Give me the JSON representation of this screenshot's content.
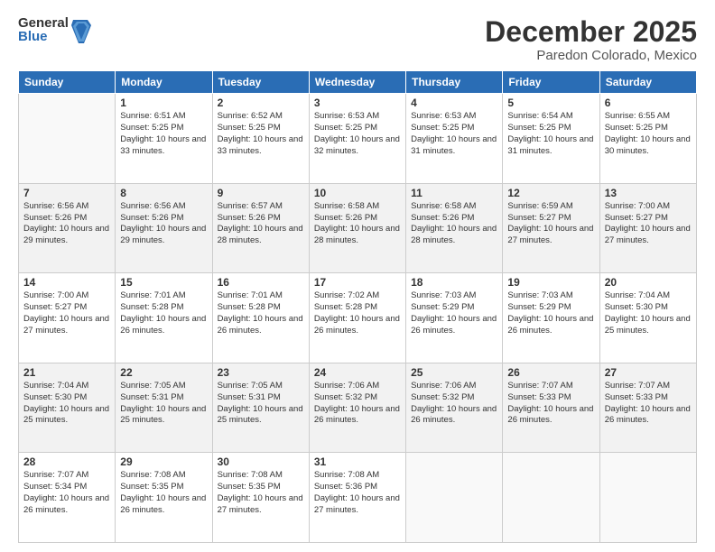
{
  "logo": {
    "general": "General",
    "blue": "Blue"
  },
  "title": "December 2025",
  "location": "Paredon Colorado, Mexico",
  "days_of_week": [
    "Sunday",
    "Monday",
    "Tuesday",
    "Wednesday",
    "Thursday",
    "Friday",
    "Saturday"
  ],
  "weeks": [
    [
      {
        "day": "",
        "info": ""
      },
      {
        "day": "1",
        "info": "Sunrise: 6:51 AM\nSunset: 5:25 PM\nDaylight: 10 hours\nand 33 minutes."
      },
      {
        "day": "2",
        "info": "Sunrise: 6:52 AM\nSunset: 5:25 PM\nDaylight: 10 hours\nand 33 minutes."
      },
      {
        "day": "3",
        "info": "Sunrise: 6:53 AM\nSunset: 5:25 PM\nDaylight: 10 hours\nand 32 minutes."
      },
      {
        "day": "4",
        "info": "Sunrise: 6:53 AM\nSunset: 5:25 PM\nDaylight: 10 hours\nand 31 minutes."
      },
      {
        "day": "5",
        "info": "Sunrise: 6:54 AM\nSunset: 5:25 PM\nDaylight: 10 hours\nand 31 minutes."
      },
      {
        "day": "6",
        "info": "Sunrise: 6:55 AM\nSunset: 5:25 PM\nDaylight: 10 hours\nand 30 minutes."
      }
    ],
    [
      {
        "day": "7",
        "info": "Sunrise: 6:56 AM\nSunset: 5:26 PM\nDaylight: 10 hours\nand 29 minutes."
      },
      {
        "day": "8",
        "info": "Sunrise: 6:56 AM\nSunset: 5:26 PM\nDaylight: 10 hours\nand 29 minutes."
      },
      {
        "day": "9",
        "info": "Sunrise: 6:57 AM\nSunset: 5:26 PM\nDaylight: 10 hours\nand 28 minutes."
      },
      {
        "day": "10",
        "info": "Sunrise: 6:58 AM\nSunset: 5:26 PM\nDaylight: 10 hours\nand 28 minutes."
      },
      {
        "day": "11",
        "info": "Sunrise: 6:58 AM\nSunset: 5:26 PM\nDaylight: 10 hours\nand 28 minutes."
      },
      {
        "day": "12",
        "info": "Sunrise: 6:59 AM\nSunset: 5:27 PM\nDaylight: 10 hours\nand 27 minutes."
      },
      {
        "day": "13",
        "info": "Sunrise: 7:00 AM\nSunset: 5:27 PM\nDaylight: 10 hours\nand 27 minutes."
      }
    ],
    [
      {
        "day": "14",
        "info": "Sunrise: 7:00 AM\nSunset: 5:27 PM\nDaylight: 10 hours\nand 27 minutes."
      },
      {
        "day": "15",
        "info": "Sunrise: 7:01 AM\nSunset: 5:28 PM\nDaylight: 10 hours\nand 26 minutes."
      },
      {
        "day": "16",
        "info": "Sunrise: 7:01 AM\nSunset: 5:28 PM\nDaylight: 10 hours\nand 26 minutes."
      },
      {
        "day": "17",
        "info": "Sunrise: 7:02 AM\nSunset: 5:28 PM\nDaylight: 10 hours\nand 26 minutes."
      },
      {
        "day": "18",
        "info": "Sunrise: 7:03 AM\nSunset: 5:29 PM\nDaylight: 10 hours\nand 26 minutes."
      },
      {
        "day": "19",
        "info": "Sunrise: 7:03 AM\nSunset: 5:29 PM\nDaylight: 10 hours\nand 26 minutes."
      },
      {
        "day": "20",
        "info": "Sunrise: 7:04 AM\nSunset: 5:30 PM\nDaylight: 10 hours\nand 25 minutes."
      }
    ],
    [
      {
        "day": "21",
        "info": "Sunrise: 7:04 AM\nSunset: 5:30 PM\nDaylight: 10 hours\nand 25 minutes."
      },
      {
        "day": "22",
        "info": "Sunrise: 7:05 AM\nSunset: 5:31 PM\nDaylight: 10 hours\nand 25 minutes."
      },
      {
        "day": "23",
        "info": "Sunrise: 7:05 AM\nSunset: 5:31 PM\nDaylight: 10 hours\nand 25 minutes."
      },
      {
        "day": "24",
        "info": "Sunrise: 7:06 AM\nSunset: 5:32 PM\nDaylight: 10 hours\nand 26 minutes."
      },
      {
        "day": "25",
        "info": "Sunrise: 7:06 AM\nSunset: 5:32 PM\nDaylight: 10 hours\nand 26 minutes."
      },
      {
        "day": "26",
        "info": "Sunrise: 7:07 AM\nSunset: 5:33 PM\nDaylight: 10 hours\nand 26 minutes."
      },
      {
        "day": "27",
        "info": "Sunrise: 7:07 AM\nSunset: 5:33 PM\nDaylight: 10 hours\nand 26 minutes."
      }
    ],
    [
      {
        "day": "28",
        "info": "Sunrise: 7:07 AM\nSunset: 5:34 PM\nDaylight: 10 hours\nand 26 minutes."
      },
      {
        "day": "29",
        "info": "Sunrise: 7:08 AM\nSunset: 5:35 PM\nDaylight: 10 hours\nand 26 minutes."
      },
      {
        "day": "30",
        "info": "Sunrise: 7:08 AM\nSunset: 5:35 PM\nDaylight: 10 hours\nand 27 minutes."
      },
      {
        "day": "31",
        "info": "Sunrise: 7:08 AM\nSunset: 5:36 PM\nDaylight: 10 hours\nand 27 minutes."
      },
      {
        "day": "",
        "info": ""
      },
      {
        "day": "",
        "info": ""
      },
      {
        "day": "",
        "info": ""
      }
    ]
  ]
}
